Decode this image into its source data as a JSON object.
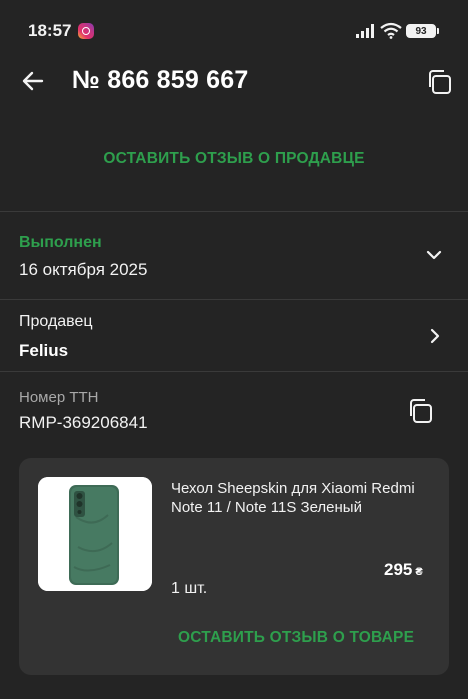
{
  "status_bar": {
    "time": "18:57",
    "battery": "93",
    "icons": [
      "instagram-icon",
      "signal-icon",
      "wifi-icon",
      "battery-icon"
    ]
  },
  "header": {
    "title": "№ 866 859 667",
    "back_icon": "arrow-left-icon",
    "copy_icon": "copy-icon"
  },
  "seller_review_button": "ОСТАВИТЬ ОТЗЫВ О ПРОДАВЦЕ",
  "order_status": {
    "status": "Выполнен",
    "date": "16 октября 2025"
  },
  "seller": {
    "label": "Продавец",
    "name": "Felius"
  },
  "ttn": {
    "label": "Номер ТТН",
    "value": "RMP-369206841"
  },
  "product": {
    "name": "Чехол Sheepskin для Xiaomi Redmi Note 11 / Note 11S Зеленый",
    "price": "295",
    "currency": "₴",
    "quantity": "1 шт.",
    "review_button": "ОСТАВИТЬ ОТЗЫВ О ТОВАРЕ"
  },
  "colors": {
    "accent_green": "#2e9f4d",
    "background": "#242424",
    "card": "#333333"
  }
}
